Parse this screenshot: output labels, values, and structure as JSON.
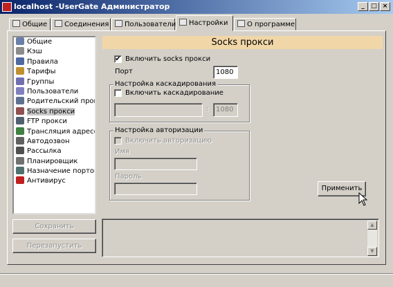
{
  "window": {
    "title": "localhost -UserGate Администратор",
    "controls": [
      "_",
      "□",
      "×"
    ]
  },
  "tabs": [
    {
      "label": "Общие",
      "icon": "general-icon",
      "active": false
    },
    {
      "label": "Соединения",
      "icon": "connections-icon",
      "active": false
    },
    {
      "label": "Пользователи",
      "icon": "users-icon",
      "active": false
    },
    {
      "label": "Настройки",
      "icon": "settings-icon",
      "active": true
    },
    {
      "label": "О программе",
      "icon": "about-icon",
      "active": false
    }
  ],
  "nav": {
    "selected": "Socks прокси",
    "items": [
      {
        "label": "Общие",
        "icon": "settings-icon",
        "color": "#6a7fa8"
      },
      {
        "label": "Кэш",
        "icon": "cache-icon",
        "color": "#8c8c8c"
      },
      {
        "label": "Правила",
        "icon": "rules-icon",
        "color": "#5068a0"
      },
      {
        "label": "Тарифы",
        "icon": "tariffs-icon",
        "color": "#c09030"
      },
      {
        "label": "Группы",
        "icon": "groups-icon",
        "color": "#7070b0"
      },
      {
        "label": "Пользователи",
        "icon": "users-icon",
        "color": "#8080c0"
      },
      {
        "label": "Родительский прокси",
        "icon": "parent-proxy-icon",
        "color": "#607090"
      },
      {
        "label": "Socks прокси",
        "icon": "socks-icon",
        "color": "#905050"
      },
      {
        "label": "FTP прокси",
        "icon": "ftp-icon",
        "color": "#506070"
      },
      {
        "label": "Трансляция адресов",
        "icon": "nat-icon",
        "color": "#408040"
      },
      {
        "label": "Автодозвон",
        "icon": "autodial-icon",
        "color": "#606060"
      },
      {
        "label": "Рассылка",
        "icon": "mailing-icon",
        "color": "#505050"
      },
      {
        "label": "Планировщик",
        "icon": "scheduler-icon",
        "color": "#707070"
      },
      {
        "label": "Назначение портов",
        "icon": "ports-icon",
        "color": "#507070"
      },
      {
        "label": "Антивирус",
        "icon": "antivirus-icon",
        "color": "#c02020"
      }
    ]
  },
  "buttons": {
    "save": "Сохранить",
    "restart": "Перезапустить",
    "apply": "Применить"
  },
  "socks": {
    "header": "Socks прокси",
    "enable_label": "Включить socks прокси",
    "enabled": "✔",
    "port_label": "Порт",
    "port_value": "1080",
    "cascade": {
      "legend": "Настройка каскадирования",
      "enable_label": "Включить каскадирование",
      "host_value": "",
      "separator": ":",
      "port_value": "1080"
    },
    "auth": {
      "legend": "Настройка авторизации",
      "enable_label": "Включить авторизацию",
      "name_label": "Имя",
      "name_value": "",
      "password_label": "Пароль",
      "password_value": ""
    }
  },
  "log": {
    "scroll_up": "▲",
    "scroll_down": "▼"
  }
}
